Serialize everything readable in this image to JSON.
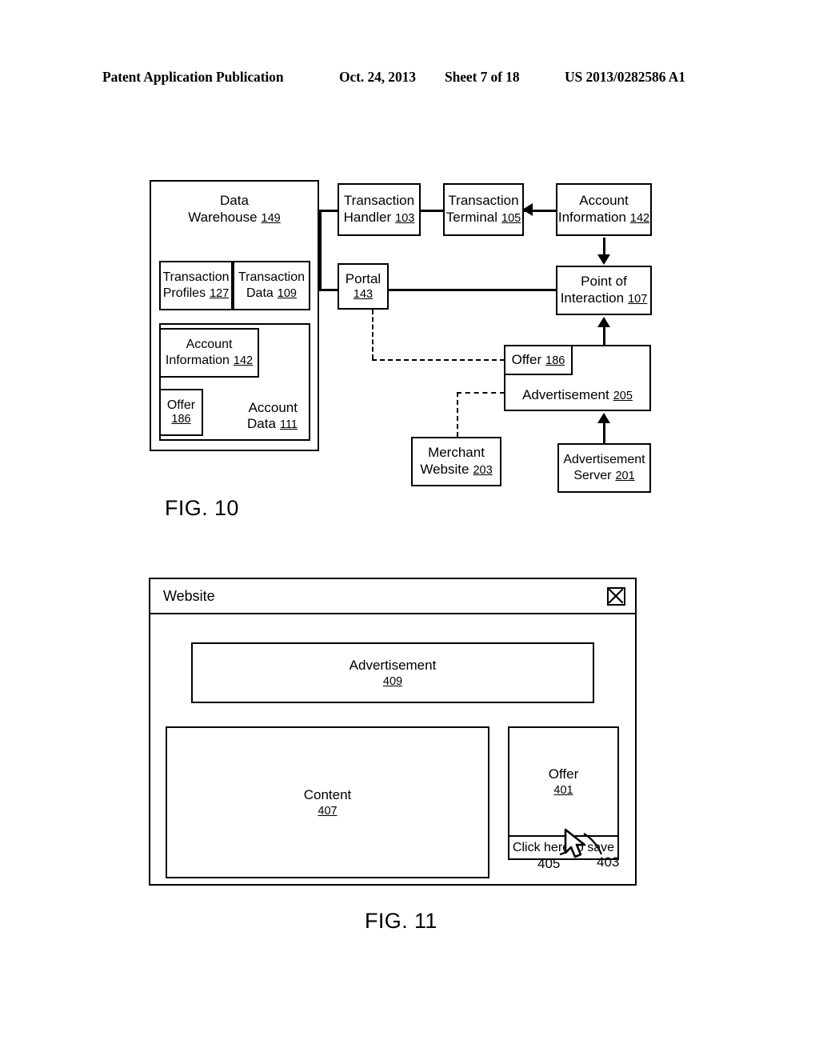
{
  "header": {
    "publication": "Patent Application Publication",
    "date": "Oct. 24, 2013",
    "sheet": "Sheet 7 of 18",
    "patent_number": "US 2013/0282586 A1"
  },
  "figures": [
    {
      "label": "FIG. 10",
      "type": "block-diagram",
      "blocks": [
        {
          "name": "data-warehouse",
          "title": "Data",
          "title2": "Warehouse",
          "ref": "149"
        },
        {
          "name": "transaction-profiles",
          "title": "Transaction",
          "title2": "Profiles",
          "ref": "127"
        },
        {
          "name": "transaction-data",
          "title": "Transaction",
          "title2": "Data",
          "ref": "109"
        },
        {
          "name": "account-data",
          "title": "Account",
          "title2": "Data",
          "ref": "111"
        },
        {
          "name": "account-information",
          "title": "Account",
          "title2": "Information",
          "ref": "142"
        },
        {
          "name": "offer-warehouse",
          "title": "Offer",
          "title2": "",
          "ref": "186"
        },
        {
          "name": "transaction-handler",
          "title": "Transaction",
          "title2": "Handler",
          "ref": "103"
        },
        {
          "name": "transaction-terminal",
          "title": "Transaction",
          "title2": "Terminal",
          "ref": "105"
        },
        {
          "name": "account-information-2",
          "title": "Account",
          "title2": "Information",
          "ref": "142"
        },
        {
          "name": "portal",
          "title": "Portal",
          "title2": "",
          "ref": "143"
        },
        {
          "name": "point-of-interaction",
          "title": "Point of",
          "title2": "Interaction",
          "ref": "107"
        },
        {
          "name": "advertisement",
          "title": "Advertisement",
          "title2": "",
          "ref": "205"
        },
        {
          "name": "offer-ad",
          "title": "Offer",
          "title2": "",
          "ref": "186"
        },
        {
          "name": "merchant-website",
          "title": "Merchant",
          "title2": "Website",
          "ref": "203"
        },
        {
          "name": "advertisement-server",
          "title": "Advertisement",
          "title2": "Server",
          "ref": "201"
        }
      ]
    },
    {
      "label": "FIG. 11",
      "type": "ui-mockup",
      "window_title": "Website",
      "close_icon": "close-box-x-icon",
      "blocks": [
        {
          "name": "advertisement-banner",
          "title": "Advertisement",
          "ref": "409"
        },
        {
          "name": "content-area",
          "title": "Content",
          "ref": "407"
        },
        {
          "name": "offer-panel",
          "title": "Offer",
          "ref": "401"
        }
      ],
      "save_button_label": "Click here to save",
      "callouts": [
        {
          "name": "callout-405",
          "ref": "405"
        },
        {
          "name": "callout-403",
          "ref": "403"
        }
      ]
    }
  ]
}
